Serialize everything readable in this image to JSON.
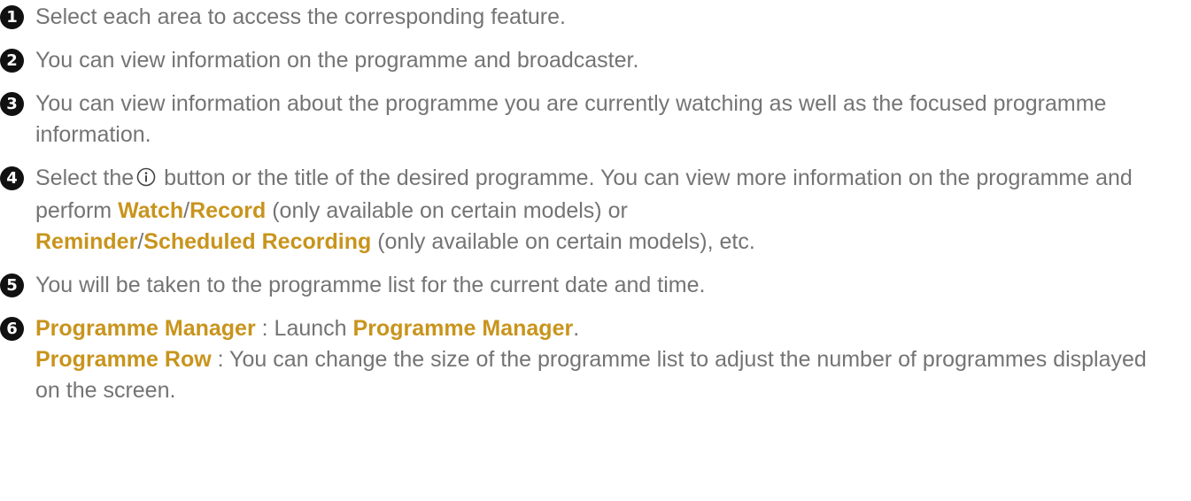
{
  "items": [
    {
      "number": "1",
      "text": "Select each area to access the corresponding feature."
    },
    {
      "number": "2",
      "text": "You can view information on the programme and broadcaster."
    },
    {
      "number": "3",
      "text": "You can view information about the programme you are currently watching as well as the focused programme information."
    },
    {
      "number": "4",
      "text_before_icon": "Select the",
      "icon": "info-circle-icon",
      "text_after_icon": "button or the title of the desired programme. You can view more information on the programme and perform",
      "watch": "Watch",
      "slash_1": "/",
      "record": "Record",
      "note_1": "(only available on certain models) or",
      "reminder": "Reminder",
      "slash_2": "/",
      "scheduled_recording": "Scheduled Recording",
      "note_2": "(only available on certain models), etc."
    },
    {
      "number": "5",
      "text": "You will be taken to the programme list for the current date and time."
    },
    {
      "number": "6",
      "programme_manager": "Programme Manager",
      "line1_middle": " : Launch ",
      "programme_manager_2": "Programme Manager",
      "line1_end": ".",
      "programme_row": "Programme Row",
      "line2_text": " : You can change the size of the programme list to adjust the number of programmes displayed on the screen."
    }
  ],
  "colors": {
    "text": "#747474",
    "highlight": "#c8941c",
    "number_badge": "#111111"
  }
}
